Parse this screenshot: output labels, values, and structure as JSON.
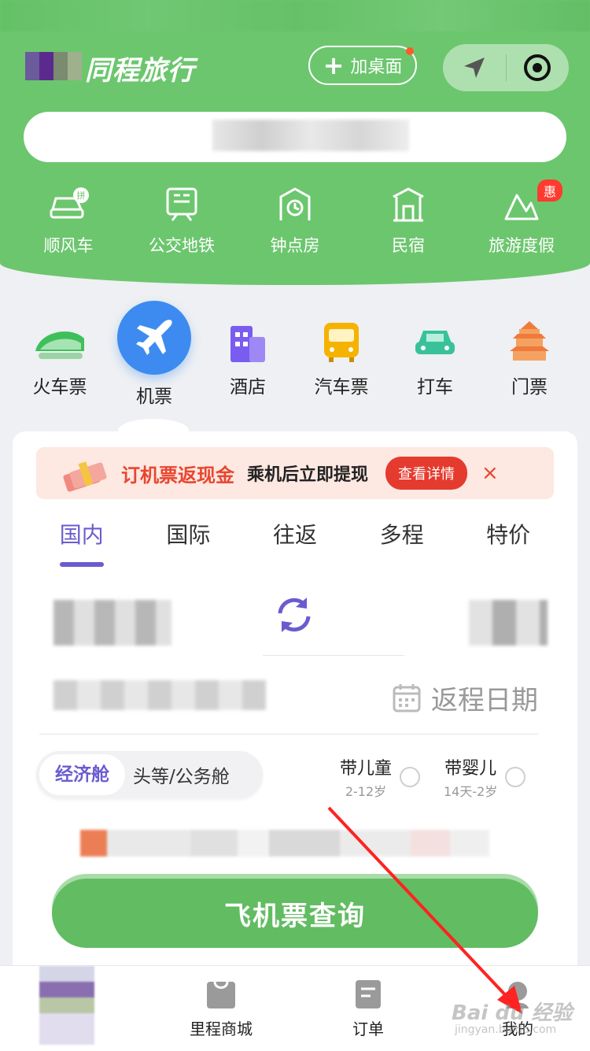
{
  "header": {
    "app_title": "同程旅行",
    "add_desktop_label": "加桌面"
  },
  "services": [
    {
      "label": "顺风车",
      "icon": "carpool-icon"
    },
    {
      "label": "公交地铁",
      "icon": "bus-metro-icon"
    },
    {
      "label": "钟点房",
      "icon": "hourly-room-icon"
    },
    {
      "label": "民宿",
      "icon": "homestay-icon"
    },
    {
      "label": "旅游度假",
      "icon": "vacation-icon",
      "badge": "惠"
    }
  ],
  "categories": [
    {
      "label": "火车票"
    },
    {
      "label": "机票"
    },
    {
      "label": "酒店"
    },
    {
      "label": "汽车票"
    },
    {
      "label": "打车"
    },
    {
      "label": "门票"
    }
  ],
  "promo": {
    "title": "订机票返现金",
    "subtitle": "乘机后立即提现",
    "button": "查看详情",
    "close": "×"
  },
  "trip_tabs": [
    "国内",
    "国际",
    "往返",
    "多程",
    "特价"
  ],
  "return_date_label": "返程日期",
  "cabin": {
    "economy": "经济舱",
    "business": "头等/公务舱"
  },
  "passengers": {
    "child_label": "带儿童",
    "child_age": "2-12岁",
    "infant_label": "带婴儿",
    "infant_age": "14天-2岁"
  },
  "search_button": "飞机票查询",
  "bottom_nav": [
    {
      "label": "里程商城"
    },
    {
      "label": "订单"
    },
    {
      "label": "我的"
    }
  ],
  "watermark": {
    "main": "Bai du 经验",
    "sub": "jingyan.baidu.com"
  },
  "colors": {
    "brand_green": "#6cc66e",
    "accent_purple": "#6a5ccf",
    "promo_red": "#e53b2e",
    "plane_blue": "#3d8bf0"
  }
}
